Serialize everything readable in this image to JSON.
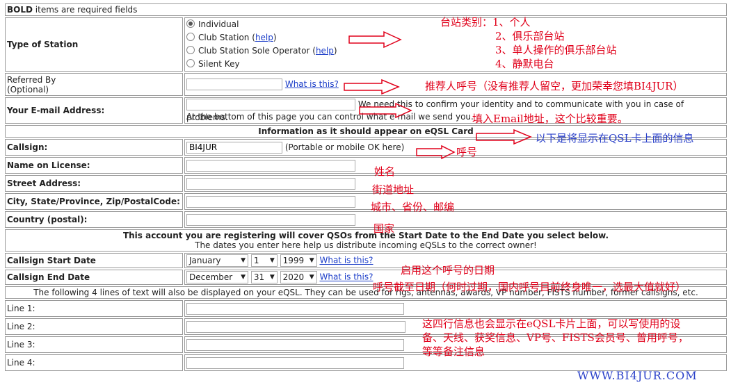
{
  "header": {
    "bold_word": "BOLD",
    "rest": " items are required fields"
  },
  "station": {
    "label": "Type of Station",
    "options": [
      {
        "text": "Individual",
        "help": "",
        "selected": true
      },
      {
        "text": "Club Station",
        "help": "help",
        "selected": false
      },
      {
        "text": "Club Station Sole Operator",
        "help": "help",
        "selected": false
      },
      {
        "text": "Silent Key",
        "help": "",
        "selected": false
      }
    ],
    "open_paren": "(",
    "close_paren": ")"
  },
  "referred": {
    "label1": "Referred By",
    "label2": "(Optional)",
    "value": "",
    "link": "What is this?"
  },
  "email": {
    "label": "Your E-mail Address:",
    "value": "",
    "help1": "We need this to confirm your identity and to communicate with you in case of problems.",
    "help2": "At the bottom of this page you can control what e-mail we send you."
  },
  "card_header": "Information as it should appear on eQSL Card",
  "callsign": {
    "label": "Callsign:",
    "value": "BI4JUR",
    "hint": "(Portable or mobile OK here)"
  },
  "name": {
    "label": "Name on License:",
    "value": ""
  },
  "street": {
    "label": "Street Address:",
    "value": ""
  },
  "city": {
    "label": "City, State/Province, Zip/PostalCode:",
    "value": ""
  },
  "country": {
    "label": "Country (postal):",
    "value": ""
  },
  "coverage": {
    "line1": "This account you are registering will cover QSOs from the Start Date to the End Date you select below.",
    "line2": "The dates you enter here help us distribute incoming eQSLs to the correct owner!"
  },
  "start": {
    "label": "Callsign Start Date",
    "month": "January",
    "day": "1",
    "year": "1999",
    "link": "What is this?"
  },
  "end": {
    "label": "Callsign End Date",
    "month": "December",
    "day": "31",
    "year": "2020",
    "link": "What is this?"
  },
  "lines_note": "The following 4 lines of text will also be displayed on your eQSL. They can be used for rigs, antennas, awards, VP number, FISTS number, former callsigns, etc.",
  "lines": [
    {
      "label": "Line 1:",
      "value": ""
    },
    {
      "label": "Line 2:",
      "value": ""
    },
    {
      "label": "Line 3:",
      "value": ""
    },
    {
      "label": "Line 4:",
      "value": ""
    }
  ],
  "annotations": {
    "station1": "台站类别：1、个人",
    "station2": "2、俱乐部台站",
    "station3": "3、单人操作的俱乐部台站",
    "station4": "4、静默电台",
    "referred": "推荐人呼号（没有推荐人留空，更加荣幸您填BI4JUR）",
    "email": "填入Email地址，这个比较重要。",
    "card": "以下是将显示在QSL卡上面的信息",
    "callsign": "呼号",
    "name": "姓名",
    "street": "街道地址",
    "city": "城市、省份、邮编",
    "country": "国家",
    "start": "启用这个呼号的日期",
    "end": "呼号截至日期（何时过期，国内呼号目前终身唯一，选最大值就好）",
    "lines1": "这四行信息也会显示在eQSL卡片上面，可以写使用的设",
    "lines2": "备、天线、获奖信息、VP号、FISTS会员号、曾用呼号，",
    "lines3": "等等备注信息"
  },
  "watermark": "WWW.BI4JUR.COM",
  "colors": {
    "annotation": "#e0001a",
    "annotation_blue": "#2a40c9",
    "link": "#1a3cc8",
    "border": "#9a9a9a"
  }
}
